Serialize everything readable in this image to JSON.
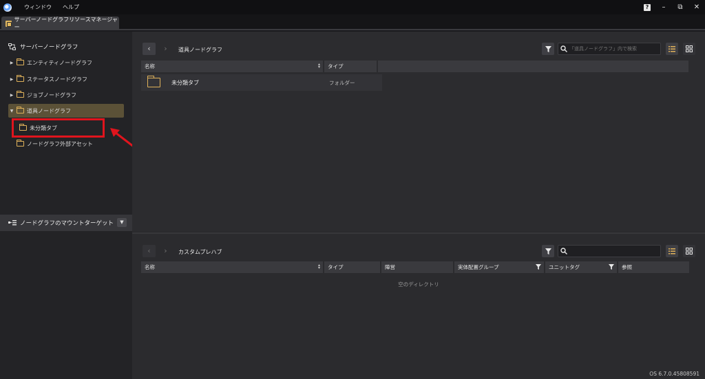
{
  "titlebar": {
    "menu": [
      "ウィンドウ",
      "ヘルプ"
    ],
    "help_label": "?",
    "minimize_label": "–",
    "restore_label": "⧉",
    "close_label": "✕"
  },
  "tab": {
    "label": "サーバーノードグラフリソースマネージャー"
  },
  "sidebar": {
    "root_label": "サーバーノードグラフ",
    "items": [
      {
        "label": "エンティティノードグラフ",
        "arrow": "▶"
      },
      {
        "label": "ステータスノードグラフ",
        "arrow": "▶"
      },
      {
        "label": "ジョブノードグラフ",
        "arrow": "▶"
      },
      {
        "label": "道具ノードグラフ",
        "arrow": "▼"
      },
      {
        "label": "未分類タブ",
        "arrow": ""
      },
      {
        "label": "ノードグラフ外部アセット",
        "arrow": ""
      }
    ],
    "mount_label": "ノードグラフのマウントターゲット",
    "mount_dropdown": "▼"
  },
  "top_panel": {
    "back": "‹",
    "forward": "›",
    "path": "道具ノードグラフ",
    "search_placeholder": "「道具ノードグラフ」内で検索",
    "columns": [
      "名称",
      "タイプ"
    ],
    "rows": [
      {
        "name": "未分類タブ",
        "type": "フォルダー"
      }
    ]
  },
  "bottom_panel": {
    "back": "‹",
    "forward": "›",
    "path": "カスタムプレハブ",
    "search_placeholder": "",
    "columns": [
      "名称",
      "タイプ",
      "陣営",
      "実体配置グループ",
      "ユニットタグ",
      "参照"
    ],
    "empty_text": "空のディレクトリ"
  },
  "version": "OS 6.7.0.45808591",
  "colors": {
    "accent": "#e0b25a",
    "highlight": "#e0141d",
    "selected": "#5b5137"
  }
}
